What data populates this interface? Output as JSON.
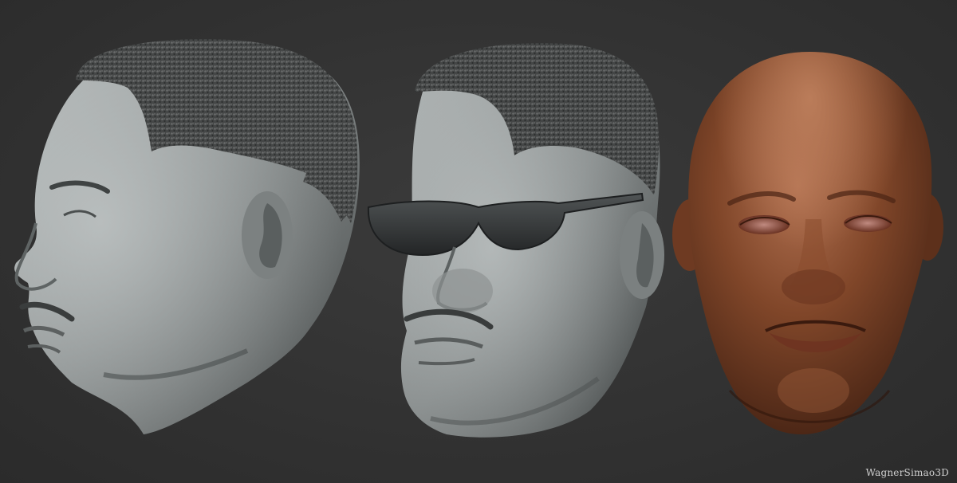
{
  "watermark": {
    "text": "WagnerSimao3D"
  },
  "renders": [
    {
      "name": "sculpt-profile-view",
      "material": "gray-clay",
      "view": "left-profile",
      "accessory": "none"
    },
    {
      "name": "sculpt-three-quarter-sunglasses",
      "material": "gray-clay",
      "view": "three-quarter",
      "accessory": "sunglasses"
    },
    {
      "name": "sculpt-front-skin-shaded",
      "material": "skin-brown",
      "view": "front",
      "accessory": "none"
    }
  ],
  "colors": {
    "background": "#303030",
    "clay_light": "#a9aeae",
    "clay_mid": "#7d8282",
    "clay_dark": "#3e4242",
    "hair": "#4a4c4c",
    "glasses": "#2d2f30",
    "skin_light": "#a86a45",
    "skin_mid": "#7a4428",
    "skin_dark": "#3e1f12"
  }
}
